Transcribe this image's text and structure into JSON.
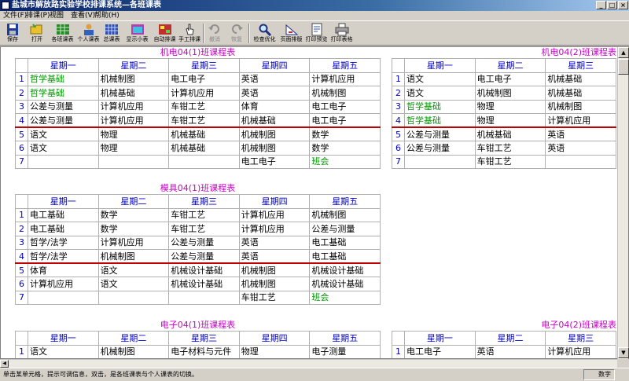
{
  "window": {
    "title": "盐城市解放路实验学校排课系统—各班课表"
  },
  "menu": [
    "文件(F)",
    "排课(P)",
    "视图",
    "查看(V)",
    "帮助(H)"
  ],
  "toolbar": {
    "buttons": [
      {
        "label": "保存",
        "icon": "save-icon"
      },
      {
        "label": "打开",
        "icon": "open-icon"
      },
      {
        "label": "各班课表",
        "icon": "class-table-icon"
      },
      {
        "label": "个人课表",
        "icon": "personal-table-icon"
      },
      {
        "label": "总课表",
        "icon": "master-table-icon"
      },
      {
        "label": "显示小表",
        "icon": "small-table-icon"
      },
      {
        "label": "自动排课",
        "icon": "auto-schedule-icon"
      },
      {
        "label": "手工排课",
        "icon": "manual-schedule-icon"
      },
      {
        "label": "撤消",
        "icon": "undo-icon",
        "disabled": true
      },
      {
        "label": "恢复",
        "icon": "redo-icon",
        "disabled": true
      },
      {
        "label": "检查优化",
        "icon": "check-icon"
      },
      {
        "label": "页面排版",
        "icon": "layout-icon"
      },
      {
        "label": "打印预览",
        "icon": "print-preview-icon"
      },
      {
        "label": "打印表格",
        "icon": "print-icon"
      }
    ]
  },
  "days5": [
    "星期一",
    "星期二",
    "星期三",
    "星期四",
    "星期五"
  ],
  "days3": [
    "星期一",
    "星期二",
    "星期三"
  ],
  "timetables": [
    {
      "title": "机电04(1)班课程表",
      "rows": [
        {
          "n": "1",
          "c": [
            "哲学基础",
            "机械制图",
            "电工电子",
            "英语",
            "计算机应用"
          ]
        },
        {
          "n": "2",
          "c": [
            "哲学基础",
            "机械基础",
            "计算机应用",
            "英语",
            "机械制图"
          ]
        },
        {
          "n": "3",
          "c": [
            "公差与测量",
            "计算机应用",
            "车钳工艺",
            "体育",
            "电工电子"
          ]
        },
        {
          "n": "4",
          "c": [
            "公差与测量",
            "计算机应用",
            "车钳工艺",
            "机械基础",
            "电工电子"
          ]
        },
        {
          "n": "5",
          "c": [
            "语文",
            "物理",
            "机械基础",
            "机械制图",
            "数学"
          ]
        },
        {
          "n": "6",
          "c": [
            "语文",
            "物理",
            "机械基础",
            "机械制图",
            "数学"
          ]
        },
        {
          "n": "7",
          "c": [
            "",
            "",
            "",
            "电工电子",
            "班会"
          ]
        }
      ]
    },
    {
      "title": "机电04(2)班课程表",
      "rows": [
        {
          "n": "1",
          "c": [
            "语文",
            "电工电子",
            "机械基础"
          ]
        },
        {
          "n": "2",
          "c": [
            "语文",
            "机械制图",
            "机械基础"
          ]
        },
        {
          "n": "3",
          "c": [
            "哲学基础",
            "物理",
            "机械制图"
          ]
        },
        {
          "n": "4",
          "c": [
            "哲学基础",
            "物理",
            "计算机应用"
          ]
        },
        {
          "n": "5",
          "c": [
            "公差与测量",
            "机械基础",
            "英语"
          ]
        },
        {
          "n": "6",
          "c": [
            "公差与测量",
            "车钳工艺",
            "英语"
          ]
        },
        {
          "n": "7",
          "c": [
            "",
            "车钳工艺",
            ""
          ]
        }
      ]
    },
    {
      "title": "模具04(1)班课程表",
      "rows": [
        {
          "n": "1",
          "c": [
            "电工基础",
            "数学",
            "车钳工艺",
            "计算机应用",
            "机械制图"
          ]
        },
        {
          "n": "2",
          "c": [
            "电工基础",
            "数学",
            "车钳工艺",
            "计算机应用",
            "公差与测量"
          ]
        },
        {
          "n": "3",
          "c": [
            "哲学/法学",
            "计算机应用",
            "公差与测量",
            "英语",
            "电工基础"
          ]
        },
        {
          "n": "4",
          "c": [
            "哲学/法学",
            "机械制图",
            "公差与测量",
            "英语",
            "电工基础"
          ]
        },
        {
          "n": "5",
          "c": [
            "体育",
            "语文",
            "机械设计基础",
            "机械制图",
            "机械设计基础"
          ]
        },
        {
          "n": "6",
          "c": [
            "计算机应用",
            "语文",
            "机械设计基础",
            "机械制图",
            "机械设计基础"
          ]
        },
        {
          "n": "7",
          "c": [
            "",
            "",
            "",
            "车钳工艺",
            "班会"
          ]
        }
      ]
    },
    {
      "title": "电子04(1)班课程表",
      "rows": [
        {
          "n": "1",
          "c": [
            "语文",
            "机械制图",
            "电子材料与元件",
            "物理",
            "电子测量"
          ]
        }
      ]
    },
    {
      "title": "电子04(2)班课程表",
      "rows": [
        {
          "n": "1",
          "c": [
            "电工电子",
            "英语",
            "计算机应用"
          ]
        }
      ]
    }
  ],
  "status": {
    "text": "单击某单元格，提示可调信息，双击，是各班课表与个人课表的切换。",
    "mode": "数字"
  }
}
